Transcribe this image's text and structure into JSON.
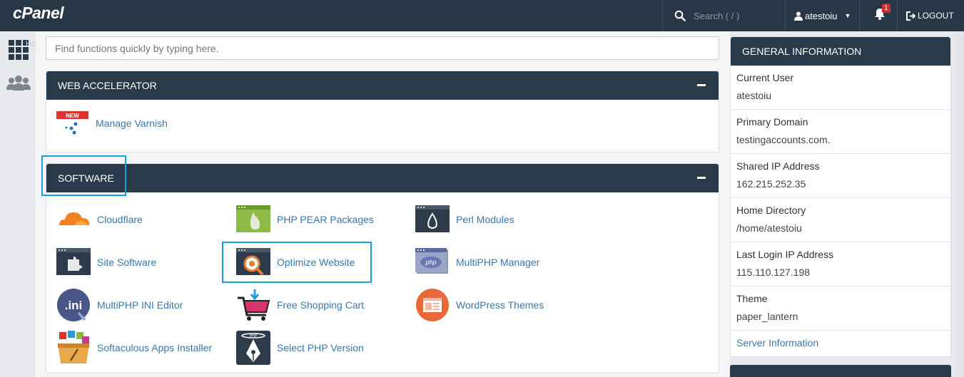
{
  "header": {
    "logo": "cPanel",
    "search_placeholder": "Search ( / )",
    "username": "atestoiu",
    "notification_count": "1",
    "logout_label": "LOGOUT"
  },
  "rail": {
    "home_label": "Home"
  },
  "quick_search": {
    "placeholder": "Find functions quickly by typing here."
  },
  "web_accelerator": {
    "title": "WEB ACCELERATOR",
    "new_badge": "NEW",
    "items": [
      {
        "label": "Manage Varnish",
        "icon": "varnish-icon"
      }
    ]
  },
  "software": {
    "title": "SOFTWARE",
    "items": [
      {
        "label": "Cloudflare",
        "icon": "cloudflare-icon"
      },
      {
        "label": "PHP PEAR Packages",
        "icon": "php-pear-icon"
      },
      {
        "label": "Perl Modules",
        "icon": "perl-icon"
      },
      {
        "label": "Site Software",
        "icon": "site-software-icon"
      },
      {
        "label": "Optimize Website",
        "icon": "optimize-website-icon"
      },
      {
        "label": "MultiPHP Manager",
        "icon": "multiphp-manager-icon"
      },
      {
        "label": "MultiPHP INI Editor",
        "icon": "multiphp-ini-icon"
      },
      {
        "label": "Free Shopping Cart",
        "icon": "shopping-cart-icon"
      },
      {
        "label": "WordPress Themes",
        "icon": "wordpress-themes-icon"
      },
      {
        "label": "Softaculous Apps Installer",
        "icon": "softaculous-icon"
      },
      {
        "label": "Select PHP Version",
        "icon": "select-php-icon"
      }
    ]
  },
  "general_info": {
    "title": "GENERAL INFORMATION",
    "rows": [
      {
        "label": "Current User",
        "value": "atestoiu"
      },
      {
        "label": "Primary Domain",
        "value": "testingaccounts.com."
      },
      {
        "label": "Shared IP Address",
        "value": "162.215.252.35"
      },
      {
        "label": "Home Directory",
        "value": "/home/atestoiu"
      },
      {
        "label": "Last Login IP Address",
        "value": "115.110.127.198"
      },
      {
        "label": "Theme",
        "value": "paper_lantern"
      }
    ],
    "server_info_link": "Server Information"
  },
  "colors": {
    "header_bg": "#283746",
    "panel_head": "#293a4a",
    "link": "#3b78a8",
    "highlight": "#1a9fd8"
  }
}
